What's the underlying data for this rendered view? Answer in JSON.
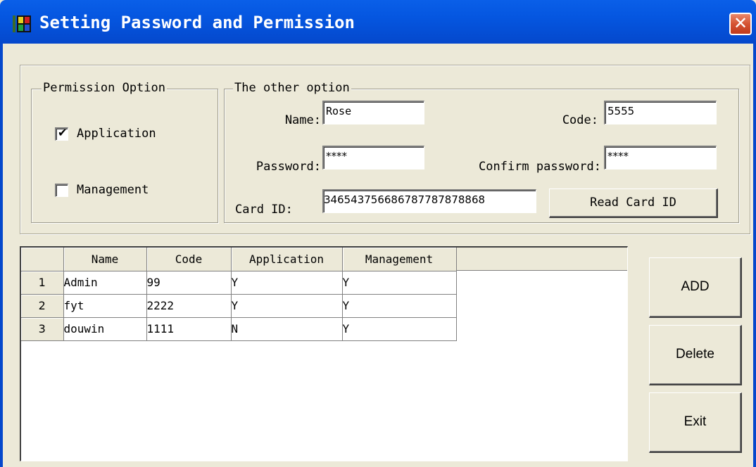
{
  "window": {
    "title": "Setting Password and Permission",
    "close_glyph": "✕",
    "icon": "app-icon",
    "accent_color": "#0548cc"
  },
  "permission_group": {
    "legend": "Permission Option",
    "options": [
      {
        "label": "Application",
        "checked": true
      },
      {
        "label": "Management",
        "checked": false
      }
    ]
  },
  "other_group": {
    "legend": "The other option",
    "name": {
      "label": "Name:",
      "value": "Rose"
    },
    "code": {
      "label": "Code:",
      "value": "5555"
    },
    "password": {
      "label": "Password:",
      "value": "****"
    },
    "confirm_password": {
      "label": "Confirm password:",
      "value": "****"
    },
    "card_id": {
      "label": "Card ID:",
      "value": "346543756686787787878868"
    },
    "read_card_button": "Read Card ID"
  },
  "grid": {
    "columns": [
      "Name",
      "Code",
      "Application",
      "Management"
    ],
    "rows": [
      {
        "num": "1",
        "name": "Admin",
        "code": "99",
        "application": "Y",
        "management": "Y"
      },
      {
        "num": "2",
        "name": "fyt",
        "code": "2222",
        "application": "Y",
        "management": "Y"
      },
      {
        "num": "3",
        "name": "douwin",
        "code": "1111",
        "application": "N",
        "management": "Y"
      }
    ]
  },
  "buttons": {
    "add": "ADD",
    "delete": "Delete",
    "exit": "Exit"
  }
}
